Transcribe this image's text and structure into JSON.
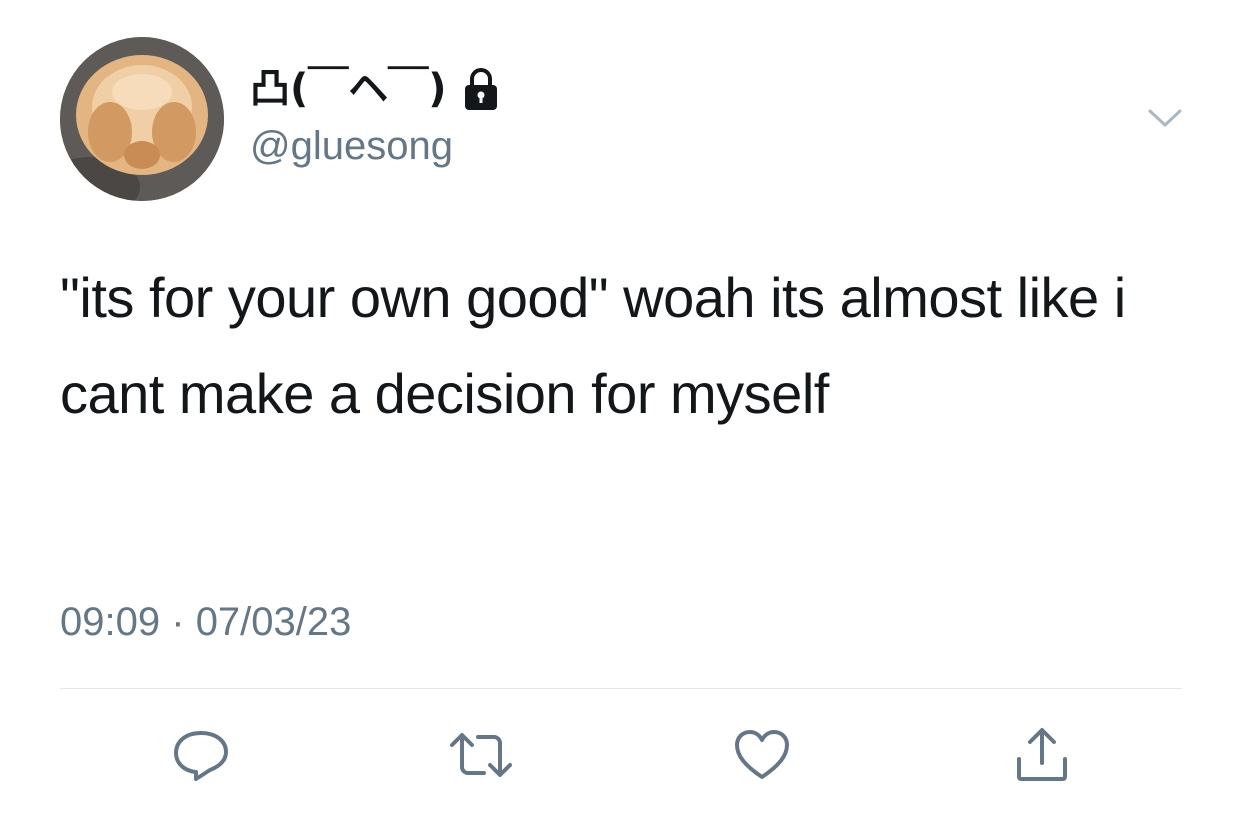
{
  "author": {
    "display_name": "凸(￣ヘ￣)",
    "handle": "@gluesong",
    "protected": true
  },
  "tweet": {
    "text": "\"its for your own good\" woah its almost like i cant make a decision for myself",
    "time": "09:09",
    "separator": "·",
    "date": "07/03/23"
  },
  "icons": {
    "lock": "lock-icon",
    "more": "chevron-down-icon",
    "reply": "reply-icon",
    "retweet": "retweet-icon",
    "like": "heart-icon",
    "share": "share-icon"
  },
  "colors": {
    "text": "#14171a",
    "secondary": "#657786",
    "divider": "#e1e8ed"
  }
}
